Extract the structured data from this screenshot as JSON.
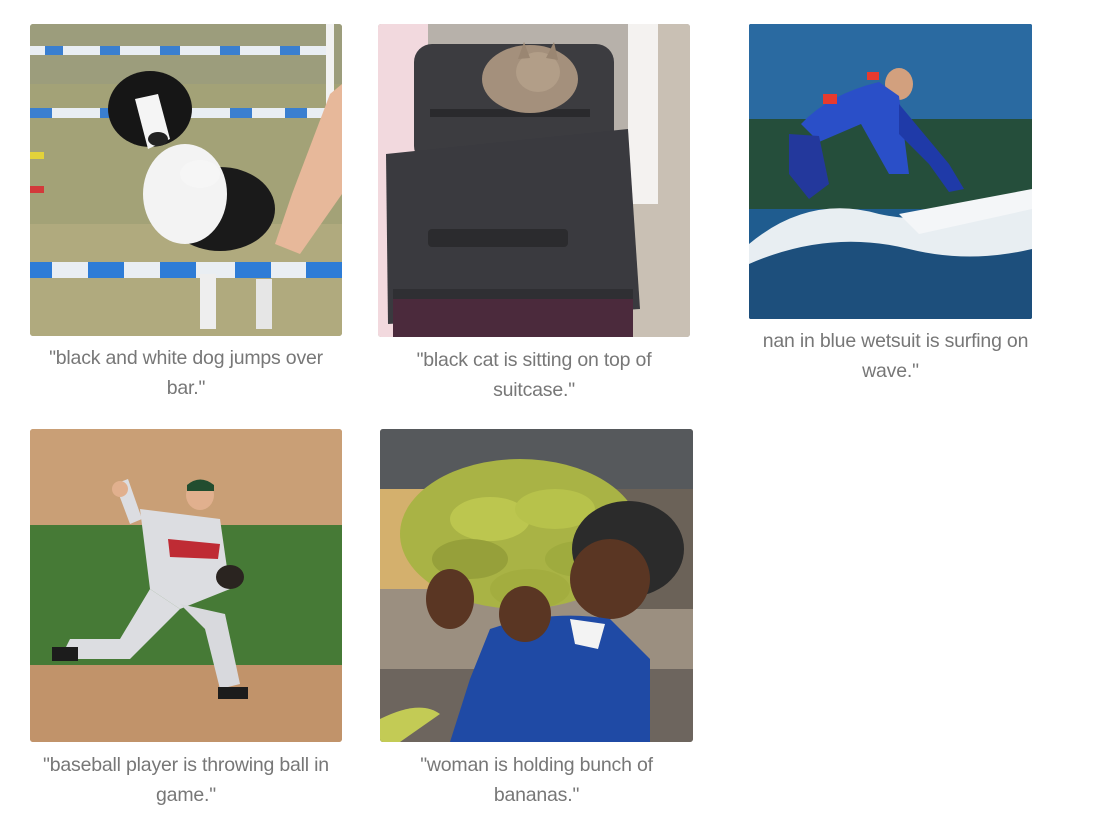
{
  "gallery": {
    "items": [
      {
        "image": "dog-jumping-over-bar-photo",
        "caption": "\"black and white dog jumps over bar.\""
      },
      {
        "image": "cat-on-suitcase-photo",
        "caption": "\"black cat is sitting on top of suitcase.\""
      },
      {
        "image": "surfer-on-wave-photo",
        "caption_line1": "nan in blue wetsuit is surfing on",
        "caption_line2": "wave.\""
      },
      {
        "image": "baseball-pitcher-photo",
        "caption": "\"baseball player is throwing ball in game.\""
      },
      {
        "image": "woman-holding-bananas-photo",
        "caption": "\"woman is holding bunch of bananas.\""
      }
    ]
  }
}
